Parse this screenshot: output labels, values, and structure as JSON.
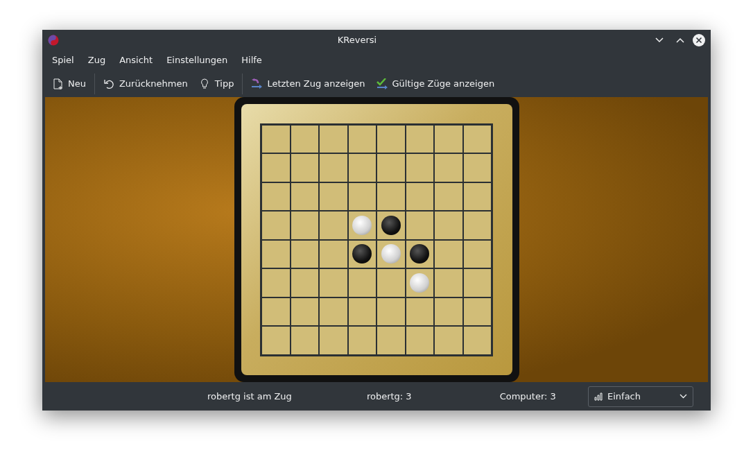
{
  "window": {
    "title": "KReversi"
  },
  "menu": [
    "Spiel",
    "Zug",
    "Ansicht",
    "Einstellungen",
    "Hilfe"
  ],
  "toolbar": [
    {
      "kind": "new",
      "label": "Neu"
    },
    {
      "kind": "undo",
      "label": "Zurücknehmen"
    },
    {
      "kind": "hint",
      "label": "Tipp"
    },
    {
      "kind": "last",
      "label": "Letzten Zug anzeigen"
    },
    {
      "kind": "legal",
      "label": "Gültige Züge anzeigen"
    }
  ],
  "board": [
    [
      {
        "stone": false
      },
      {
        "stone": false
      },
      {
        "stone": false
      },
      {
        "stone": false
      },
      {
        "stone": false
      },
      {
        "stone": false
      },
      {
        "stone": false
      },
      {
        "stone": false
      }
    ],
    [
      {
        "stone": false
      },
      {
        "stone": false
      },
      {
        "stone": false
      },
      {
        "stone": false
      },
      {
        "stone": false
      },
      {
        "stone": false
      },
      {
        "stone": false
      },
      {
        "stone": false
      }
    ],
    [
      {
        "stone": false
      },
      {
        "stone": false
      },
      {
        "stone": false
      },
      {
        "stone": false
      },
      {
        "stone": false
      },
      {
        "stone": false
      },
      {
        "stone": false
      },
      {
        "stone": false
      }
    ],
    [
      {
        "stone": false
      },
      {
        "stone": false
      },
      {
        "stone": false
      },
      {
        "stone": true,
        "white": true
      },
      {
        "stone": true,
        "white": false
      },
      {
        "stone": false
      },
      {
        "stone": false
      },
      {
        "stone": false
      }
    ],
    [
      {
        "stone": false
      },
      {
        "stone": false
      },
      {
        "stone": false
      },
      {
        "stone": true,
        "white": false
      },
      {
        "stone": true,
        "white": true
      },
      {
        "stone": true,
        "white": false
      },
      {
        "stone": false
      },
      {
        "stone": false
      }
    ],
    [
      {
        "stone": false
      },
      {
        "stone": false
      },
      {
        "stone": false
      },
      {
        "stone": false
      },
      {
        "stone": false
      },
      {
        "stone": true,
        "white": true
      },
      {
        "stone": false
      },
      {
        "stone": false
      }
    ],
    [
      {
        "stone": false
      },
      {
        "stone": false
      },
      {
        "stone": false
      },
      {
        "stone": false
      },
      {
        "stone": false
      },
      {
        "stone": false
      },
      {
        "stone": false
      },
      {
        "stone": false
      }
    ],
    [
      {
        "stone": false
      },
      {
        "stone": false
      },
      {
        "stone": false
      },
      {
        "stone": false
      },
      {
        "stone": false
      },
      {
        "stone": false
      },
      {
        "stone": false
      },
      {
        "stone": false
      }
    ]
  ],
  "status_bar": {
    "turn": "robertg ist am Zug",
    "player_score": "robertg: 3",
    "computer_score": "Computer: 3",
    "difficulty": "Einfach"
  }
}
